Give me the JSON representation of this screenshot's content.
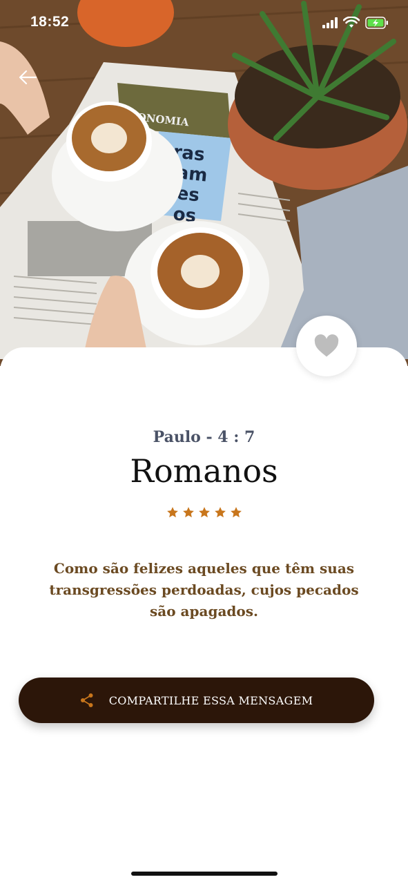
{
  "status_bar": {
    "time": "18:52",
    "icons": [
      "cellular-signal-icon",
      "wifi-icon",
      "battery-charging-icon"
    ]
  },
  "navigation": {
    "back_icon": "arrow-left-icon"
  },
  "hero": {
    "newspaper_section": "ECONOMIA",
    "headline_fragments": [
      "ras",
      "am",
      "es",
      "os"
    ]
  },
  "favorite": {
    "icon": "heart-icon",
    "active": false
  },
  "verse_card": {
    "reference": "Paulo - 4 : 7",
    "book": "Romanos",
    "rating": 5,
    "rating_max": 5,
    "text": "Como são felizes aqueles que têm suas transgressões perdoadas, cujos pecados são apagados."
  },
  "share_button": {
    "label": "COMPARTILHE ESSA MENSAGEM",
    "icon": "share-icon"
  },
  "colors": {
    "accent_orange": "#c8761c",
    "verse_text": "#6b4a22",
    "button_bg": "#2c1609",
    "reference_text": "#4a5266",
    "battery_green": "#5ee04b"
  }
}
